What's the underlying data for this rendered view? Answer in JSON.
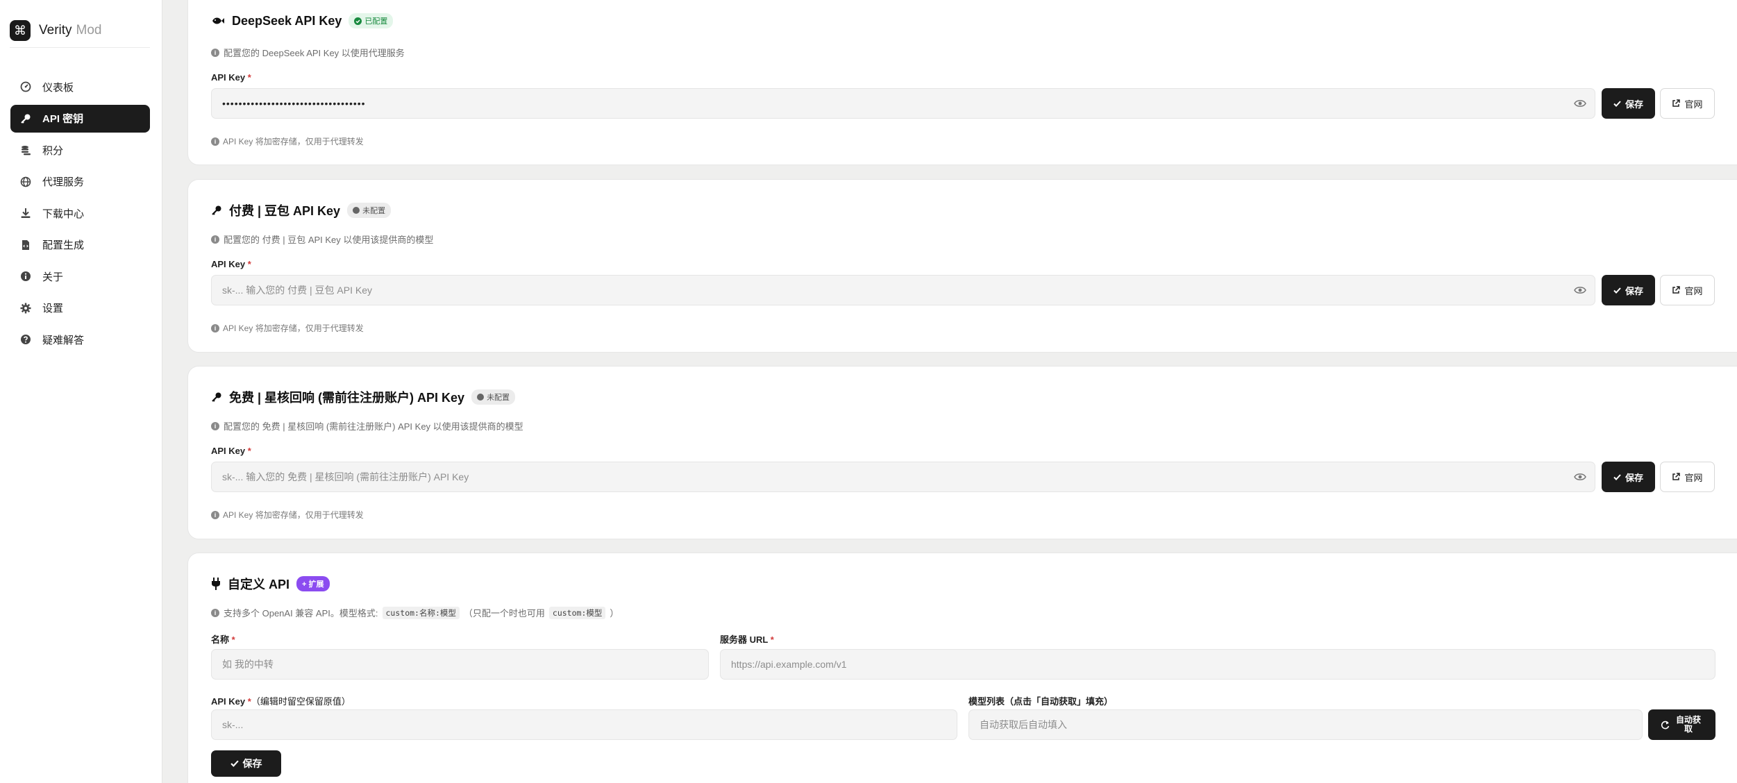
{
  "app": {
    "logo_glyph": "⌘",
    "name": "Verity",
    "name_suffix": "Mod"
  },
  "sidebar": {
    "items": [
      {
        "label": "仪表板",
        "icon": "gauge-icon",
        "active": false
      },
      {
        "label": "API 密钥",
        "icon": "key-icon",
        "active": true
      },
      {
        "label": "积分",
        "icon": "coins-icon",
        "active": false
      },
      {
        "label": "代理服务",
        "icon": "globe-icon",
        "active": false
      },
      {
        "label": "下载中心",
        "icon": "download-icon",
        "active": false
      },
      {
        "label": "配置生成",
        "icon": "file-code-icon",
        "active": false
      },
      {
        "label": "关于",
        "icon": "info-icon",
        "active": false
      },
      {
        "label": "设置",
        "icon": "gear-icon",
        "active": false
      },
      {
        "label": "疑难解答",
        "icon": "question-icon",
        "active": false
      }
    ]
  },
  "providers": [
    {
      "title": "DeepSeek API Key",
      "icon": "fish-icon",
      "status": "已配置",
      "status_kind": "configured",
      "description": "配置您的 DeepSeek API Key 以使用代理服务",
      "field_label": "API Key",
      "required_mark": "*",
      "value": "•••••••••••••••••••••••••••••••••••",
      "placeholder": "",
      "save_label": "保存",
      "site_label": "官网",
      "note": "API Key 将加密存储，仅用于代理转发"
    },
    {
      "title": "付费 | 豆包 API Key",
      "icon": "key-icon",
      "status": "未配置",
      "status_kind": "unconfigured",
      "description": "配置您的 付费 | 豆包 API Key 以使用该提供商的模型",
      "field_label": "API Key",
      "required_mark": "*",
      "value": "",
      "placeholder": "sk-... 输入您的 付费 | 豆包 API Key",
      "save_label": "保存",
      "site_label": "官网",
      "note": "API Key 将加密存储，仅用于代理转发"
    },
    {
      "title": "免费 | 星核回响 (需前往注册账户) API Key",
      "icon": "key-icon",
      "status": "未配置",
      "status_kind": "unconfigured",
      "description": "配置您的 免费 | 星核回响 (需前往注册账户) API Key 以使用该提供商的模型",
      "field_label": "API Key",
      "required_mark": "*",
      "value": "",
      "placeholder": "sk-... 输入您的 免费 | 星核回响 (需前往注册账户) API Key",
      "save_label": "保存",
      "site_label": "官网",
      "note": "API Key 将加密存储，仅用于代理转发"
    }
  ],
  "custom": {
    "title": "自定义 API",
    "icon": "plug-icon",
    "badge": "+ 扩展",
    "desc_prefix": "支持多个 OpenAI 兼容 API。模型格式:",
    "desc_code1": "custom:名称:模型",
    "desc_mid": "（只配一个时也可用",
    "desc_code2": "custom:模型",
    "desc_suffix": "）",
    "name_label": "名称",
    "name_placeholder": "如 我的中转",
    "url_label": "服务器 URL",
    "url_placeholder": "https://api.example.com/v1",
    "key_label": "API Key",
    "key_hint": "（编辑时留空保留原值）",
    "key_placeholder": "sk-...",
    "models_label": "模型列表（点击「自动获取」填充）",
    "models_placeholder": "自动获取后自动填入",
    "autofetch_label": "自动获取",
    "save_label": "保存",
    "required_mark": "*"
  },
  "colors": {
    "accent_dark": "#1c1c1c",
    "configured_green": "#198a3f",
    "extension_purple": "#8b4cf0",
    "required_red": "#d23b3b"
  }
}
